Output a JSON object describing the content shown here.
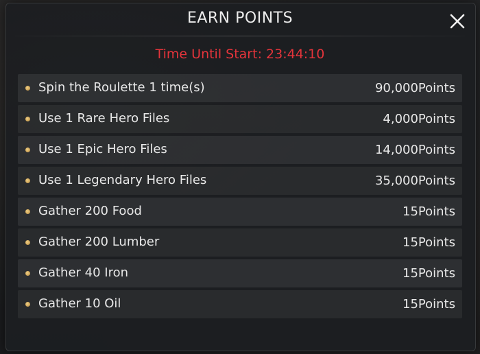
{
  "header": {
    "title": "EARN POINTS",
    "close_icon": "close-icon"
  },
  "timer": {
    "text": "Time Until Start: 23:44:10",
    "color": "#e4343b"
  },
  "tasks": [
    {
      "label": "Spin the Roulette 1 time(s)",
      "points": "90,000Points"
    },
    {
      "label": "Use 1 Rare Hero Files",
      "points": "4,000Points"
    },
    {
      "label": "Use 1 Epic Hero Files",
      "points": "14,000Points"
    },
    {
      "label": "Use 1 Legendary Hero Files",
      "points": "35,000Points"
    },
    {
      "label": "Gather 200 Food",
      "points": "15Points"
    },
    {
      "label": "Gather 200 Lumber",
      "points": "15Points"
    },
    {
      "label": "Gather 40 Iron",
      "points": "15Points"
    },
    {
      "label": "Gather 10 Oil",
      "points": "15Points"
    }
  ],
  "colors": {
    "bullet": "#d9ad5c",
    "text": "#e8e8e8"
  }
}
